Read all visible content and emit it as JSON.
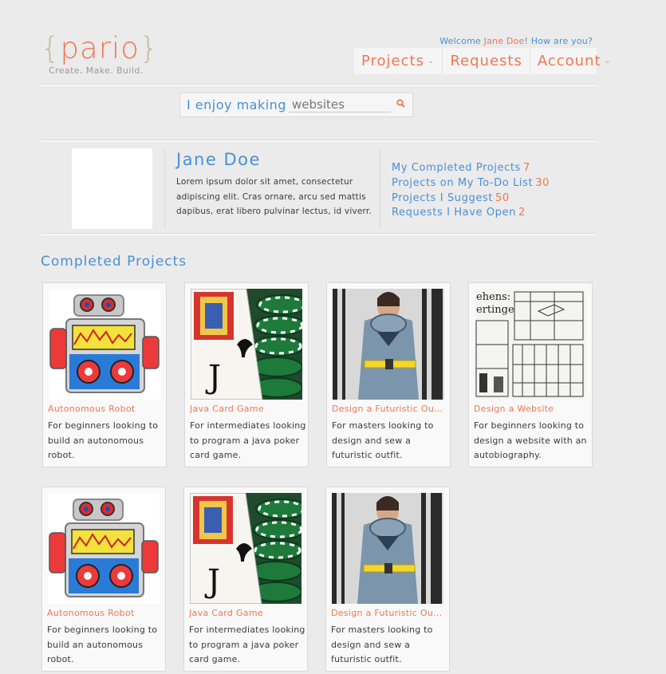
{
  "brand": {
    "logo_open": "{",
    "logo_text": "pario",
    "logo_close": "}",
    "tagline": "Create. Make. Build.",
    "accent": "#f07750",
    "link": "#4a8fd6"
  },
  "header": {
    "welcome_prefix": "Welcome ",
    "welcome_name": "Jane Doe",
    "welcome_suffix": "! How are you?",
    "nav": [
      {
        "label": "Projects",
        "has_dropdown": true
      },
      {
        "label": "Requests",
        "has_dropdown": false
      },
      {
        "label": "Account",
        "has_dropdown": true
      }
    ]
  },
  "search": {
    "label": "I enjoy making",
    "placeholder": "websites",
    "icon": "search-icon"
  },
  "profile": {
    "name": "Jane Doe",
    "bio": "Lorem ipsum dolor sit amet, consectetur adipiscing elit. Cras ornare, arcu sed mattis dapibus, erat libero pulvinar lectus, id viverr.",
    "stats": [
      {
        "label": "My Completed Projects",
        "value": "7"
      },
      {
        "label": "Projects on My To-Do List",
        "value": "30"
      },
      {
        "label": "Projects I Suggest",
        "value": "50"
      },
      {
        "label": "Requests I Have Open",
        "value": "2"
      }
    ]
  },
  "completed": {
    "title": "Completed Projects",
    "cards": [
      {
        "title": "Autonomous Robot",
        "desc": "For beginners looking to build an autonomous robot.",
        "image": "robot-image"
      },
      {
        "title": "Java Card Game",
        "desc": "For intermediates looking to program a java poker card game.",
        "image": "cards-image"
      },
      {
        "title": "Design a Futuristic Outfit",
        "desc": "For masters looking to design and sew a futuristic outfit.",
        "image": "fashion-image"
      },
      {
        "title": "Design a Website",
        "desc": "For beginners looking to design a website with an autobiography.",
        "image": "sketch-image"
      },
      {
        "title": "Autonomous Robot",
        "desc": "For beginners looking to build an autonomous robot.",
        "image": "robot-image"
      },
      {
        "title": "Java Card Game",
        "desc": "For intermediates looking to program a java poker card game.",
        "image": "cards-image"
      },
      {
        "title": "Design a Futuristic Outfit",
        "desc": "For masters looking to design and sew a futuristic outfit.",
        "image": "fashion-image"
      }
    ]
  }
}
